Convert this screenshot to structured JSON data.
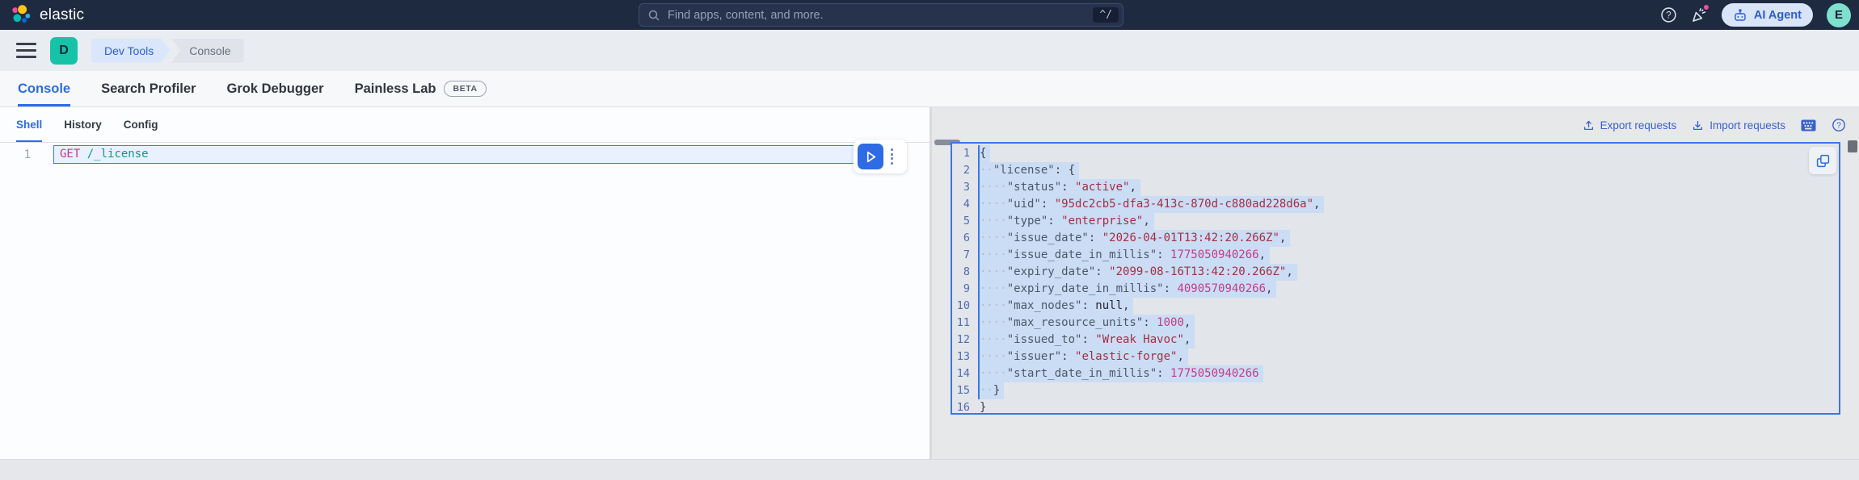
{
  "colors": {
    "topbar-bg": "#1e2a40",
    "topbar-field": "#27334d",
    "teal-badge": "#17c3a6",
    "avatar-bg": "#7ee0cd",
    "ai-btn-bg": "#d9e4f9",
    "crumb-active-bg": "#d9e6fb",
    "crumb-active-text": "#2a5fd3",
    "crumb-bg": "#e0e3ea",
    "crumb-text": "#69707d",
    "method": "#c23790",
    "url": "#0b9a8e",
    "resp-key": "#4a5a68",
    "resp-str": "#a42f3f",
    "resp-num": "#c43d82",
    "resp-null": "#23272f",
    "resp-punct": "#3a3f48",
    "selection": "#cbdcf5"
  },
  "topbar": {
    "brand": "elastic",
    "search": {
      "placeholder": "Find apps, content, and more.",
      "shortcut": "^/"
    },
    "ai_agent_label": "AI Agent",
    "avatar_initial": "E"
  },
  "breadcrumbs": {
    "space_initial": "D",
    "items": [
      "Dev Tools",
      "Console"
    ]
  },
  "tabs": [
    {
      "label": "Console",
      "active": true
    },
    {
      "label": "Search Profiler",
      "active": false
    },
    {
      "label": "Grok Debugger",
      "active": false
    },
    {
      "label": "Painless Lab",
      "active": false,
      "badge": "BETA"
    }
  ],
  "console": {
    "subtabs": [
      {
        "label": "Shell",
        "active": true
      },
      {
        "label": "History",
        "active": false
      },
      {
        "label": "Config",
        "active": false
      }
    ],
    "request": {
      "line_number": "1",
      "method": "GET",
      "path": "/_license"
    },
    "actions": {
      "export": "Export requests",
      "import": "Import requests"
    }
  },
  "response": {
    "lines": [
      {
        "num": 1,
        "indent": 0,
        "selected": true,
        "tokens": [
          {
            "t": "punct",
            "v": "{"
          }
        ]
      },
      {
        "num": 2,
        "indent": 2,
        "selected": true,
        "tokens": [
          {
            "t": "key",
            "v": "\"license\""
          },
          {
            "t": "punct",
            "v": ": {"
          }
        ]
      },
      {
        "num": 3,
        "indent": 4,
        "selected": true,
        "tokens": [
          {
            "t": "key",
            "v": "\"status\""
          },
          {
            "t": "punct",
            "v": ": "
          },
          {
            "t": "str",
            "v": "\"active\""
          },
          {
            "t": "punct",
            "v": ","
          }
        ]
      },
      {
        "num": 4,
        "indent": 4,
        "selected": true,
        "tokens": [
          {
            "t": "key",
            "v": "\"uid\""
          },
          {
            "t": "punct",
            "v": ": "
          },
          {
            "t": "str",
            "v": "\"95dc2cb5-dfa3-413c-870d-c880ad228d6a\""
          },
          {
            "t": "punct",
            "v": ","
          }
        ]
      },
      {
        "num": 5,
        "indent": 4,
        "selected": true,
        "tokens": [
          {
            "t": "key",
            "v": "\"type\""
          },
          {
            "t": "punct",
            "v": ": "
          },
          {
            "t": "str",
            "v": "\"enterprise\""
          },
          {
            "t": "punct",
            "v": ","
          }
        ]
      },
      {
        "num": 6,
        "indent": 4,
        "selected": true,
        "tokens": [
          {
            "t": "key",
            "v": "\"issue_date\""
          },
          {
            "t": "punct",
            "v": ": "
          },
          {
            "t": "str",
            "v": "\"2026-04-01T13:42:20.266Z\""
          },
          {
            "t": "punct",
            "v": ","
          }
        ]
      },
      {
        "num": 7,
        "indent": 4,
        "selected": true,
        "tokens": [
          {
            "t": "key",
            "v": "\"issue_date_in_millis\""
          },
          {
            "t": "punct",
            "v": ": "
          },
          {
            "t": "num",
            "v": "1775050940266"
          },
          {
            "t": "punct",
            "v": ","
          }
        ]
      },
      {
        "num": 8,
        "indent": 4,
        "selected": true,
        "tokens": [
          {
            "t": "key",
            "v": "\"expiry_date\""
          },
          {
            "t": "punct",
            "v": ": "
          },
          {
            "t": "str",
            "v": "\"2099-08-16T13:42:20.266Z\""
          },
          {
            "t": "punct",
            "v": ","
          }
        ]
      },
      {
        "num": 9,
        "indent": 4,
        "selected": true,
        "tokens": [
          {
            "t": "key",
            "v": "\"expiry_date_in_millis\""
          },
          {
            "t": "punct",
            "v": ": "
          },
          {
            "t": "num",
            "v": "4090570940266"
          },
          {
            "t": "punct",
            "v": ","
          }
        ]
      },
      {
        "num": 10,
        "indent": 4,
        "selected": true,
        "tokens": [
          {
            "t": "key",
            "v": "\"max_nodes\""
          },
          {
            "t": "punct",
            "v": ": "
          },
          {
            "t": "null",
            "v": "null"
          },
          {
            "t": "punct",
            "v": ","
          }
        ]
      },
      {
        "num": 11,
        "indent": 4,
        "selected": true,
        "tokens": [
          {
            "t": "key",
            "v": "\"max_resource_units\""
          },
          {
            "t": "punct",
            "v": ": "
          },
          {
            "t": "num",
            "v": "1000"
          },
          {
            "t": "punct",
            "v": ","
          }
        ]
      },
      {
        "num": 12,
        "indent": 4,
        "selected": true,
        "tokens": [
          {
            "t": "key",
            "v": "\"issued_to\""
          },
          {
            "t": "punct",
            "v": ": "
          },
          {
            "t": "str",
            "v": "\"Wreak Havoc\""
          },
          {
            "t": "punct",
            "v": ","
          }
        ]
      },
      {
        "num": 13,
        "indent": 4,
        "selected": true,
        "tokens": [
          {
            "t": "key",
            "v": "\"issuer\""
          },
          {
            "t": "punct",
            "v": ": "
          },
          {
            "t": "str",
            "v": "\"elastic-forge\""
          },
          {
            "t": "punct",
            "v": ","
          }
        ]
      },
      {
        "num": 14,
        "indent": 4,
        "selected": true,
        "tokens": [
          {
            "t": "key",
            "v": "\"start_date_in_millis\""
          },
          {
            "t": "punct",
            "v": ": "
          },
          {
            "t": "num",
            "v": "1775050940266"
          }
        ]
      },
      {
        "num": 15,
        "indent": 2,
        "selected": true,
        "tokens": [
          {
            "t": "punct",
            "v": "}"
          }
        ]
      },
      {
        "num": 16,
        "indent": 0,
        "selected": false,
        "tokens": [
          {
            "t": "punct",
            "v": "}"
          }
        ]
      }
    ]
  }
}
